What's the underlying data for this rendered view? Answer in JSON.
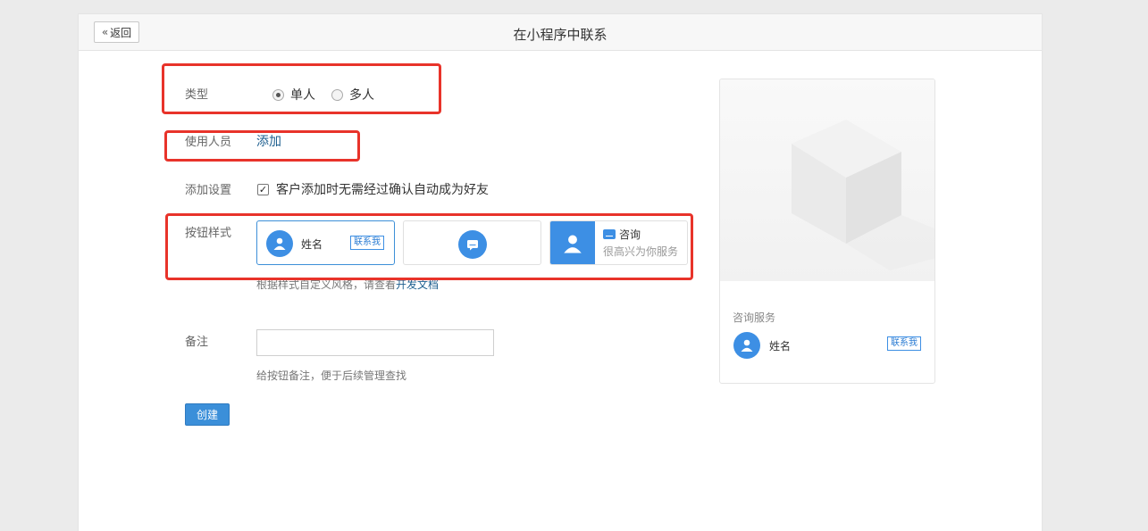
{
  "header": {
    "back_label": "返回",
    "title": "在小程序中联系"
  },
  "form": {
    "type": {
      "label": "类型",
      "options": [
        {
          "label": "单人",
          "checked": true
        },
        {
          "label": "多人",
          "checked": false
        }
      ]
    },
    "users": {
      "label": "使用人员",
      "add_link": "添加"
    },
    "add_settings": {
      "label": "添加设置",
      "checkbox_label": "客户添加时无需经过确认自动成为好友",
      "checked": true
    },
    "button_style": {
      "label": "按钮样式",
      "card1": {
        "name": "姓名",
        "badge": "联系我"
      },
      "card3": {
        "title": "咨询",
        "subtitle": "很高兴为你服务"
      },
      "hint_prefix": "根据样式自定义风格，请查看",
      "hint_link": "开发文档"
    },
    "remark": {
      "label": "备注",
      "value": "",
      "hint": "给按钮备注，便于后续管理查找"
    },
    "create_label": "创建"
  },
  "preview": {
    "service_label": "咨询服务",
    "name": "姓名",
    "badge": "联系我"
  },
  "colors": {
    "accent": "#3d8fe4",
    "annotation": "#e8332a",
    "link": "#1e5f8f"
  }
}
